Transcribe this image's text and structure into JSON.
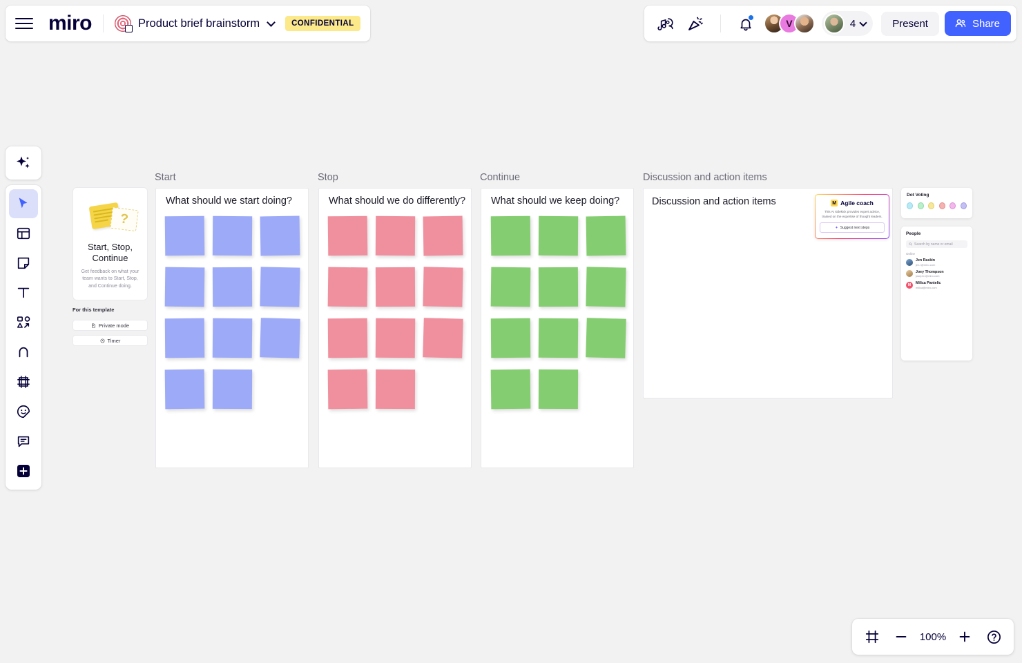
{
  "app": {
    "logo": "miro"
  },
  "header": {
    "menu_icon": "hamburger-icon",
    "board_icon": "target-board-icon",
    "board_title": "Product brief brainstorm",
    "board_title_chevron": "chevron-down-icon",
    "confidential_badge": "CONFIDENTIAL",
    "music_icon": "music-notes-icon",
    "celebrate_icon": "party-popper-icon",
    "notifications_icon": "bell-icon",
    "collaborator_initial": "V",
    "collaborator_count": "4",
    "collaborator_chevron": "chevron-down-icon",
    "present_label": "Present",
    "share_label": "Share",
    "share_icon": "people-icon"
  },
  "toolbar": {
    "ai_label": "AI tools",
    "items": [
      {
        "name": "select",
        "icon": "cursor-icon",
        "active": true
      },
      {
        "name": "templates",
        "icon": "templates-icon",
        "active": false
      },
      {
        "name": "sticky-note",
        "icon": "sticky-note-icon",
        "active": false
      },
      {
        "name": "text",
        "icon": "text-icon",
        "active": false
      },
      {
        "name": "shapes",
        "icon": "shapes-connector-icon",
        "active": false
      },
      {
        "name": "pen",
        "icon": "pen-icon",
        "active": false
      },
      {
        "name": "frame",
        "icon": "frame-icon",
        "active": false
      },
      {
        "name": "stickers",
        "icon": "sticker-smiley-icon",
        "active": false
      },
      {
        "name": "comment",
        "icon": "comment-icon",
        "active": false
      },
      {
        "name": "more-apps",
        "icon": "plus-square-icon",
        "active": false
      }
    ]
  },
  "template_card": {
    "art_icon": "cards-question-illustration",
    "title": "Start, Stop, Continue",
    "description": "Get feedback on what your team wants to Start, Stop, and Continue doing.",
    "section_label": "For this template",
    "buttons": [
      {
        "label": "Private mode",
        "icon": "private-mode-icon"
      },
      {
        "label": "Timer",
        "icon": "timer-icon"
      }
    ]
  },
  "board": {
    "frames": [
      {
        "label": "Start",
        "question": "What should we start doing?",
        "color": "#9daaf8",
        "note_count": 11
      },
      {
        "label": "Stop",
        "question": "What should we do differently?",
        "color": "#f0909e",
        "note_count": 11
      },
      {
        "label": "Continue",
        "question": "What should we keep doing?",
        "color": "#85cd71",
        "note_count": 11
      },
      {
        "label": "Discussion and action items",
        "question": "Discussion and action items",
        "color": "",
        "note_count": 0
      }
    ]
  },
  "agile_coach": {
    "badge_glyph": "M",
    "title": "Agile coach",
    "description": "This AI sidekick provides expert advice, trained on the expertise of thought leaders.",
    "button_label": "Suggest next steps",
    "button_icon": "sparkle-icon"
  },
  "dot_voting": {
    "title": "Dot Voting",
    "dots": [
      "#b8eaf5",
      "#b9efc9",
      "#f6e79a",
      "#f5b2b2",
      "#f3b7ec",
      "#c4c0f5"
    ]
  },
  "people": {
    "title": "People",
    "search_placeholder": "Search by name or email",
    "search_icon": "search-icon",
    "online_label": "Online",
    "list": [
      {
        "name": "Jen Raskin",
        "email": "jen.r@miro.com",
        "color": "#4b7bb5"
      },
      {
        "name": "Joey Thompson",
        "email": "joseph.t@miro.com",
        "color": "#d2a86a"
      },
      {
        "name": "Milica Pantelic",
        "email": "milica@miro.com",
        "color": "#f2526b",
        "initial": "M"
      }
    ]
  },
  "zoom_bar": {
    "fit_icon": "frame-fit-icon",
    "zoom_out_icon": "minus-icon",
    "zoom_level": "100%",
    "zoom_in_icon": "plus-icon",
    "help_icon": "question-circle-icon"
  }
}
